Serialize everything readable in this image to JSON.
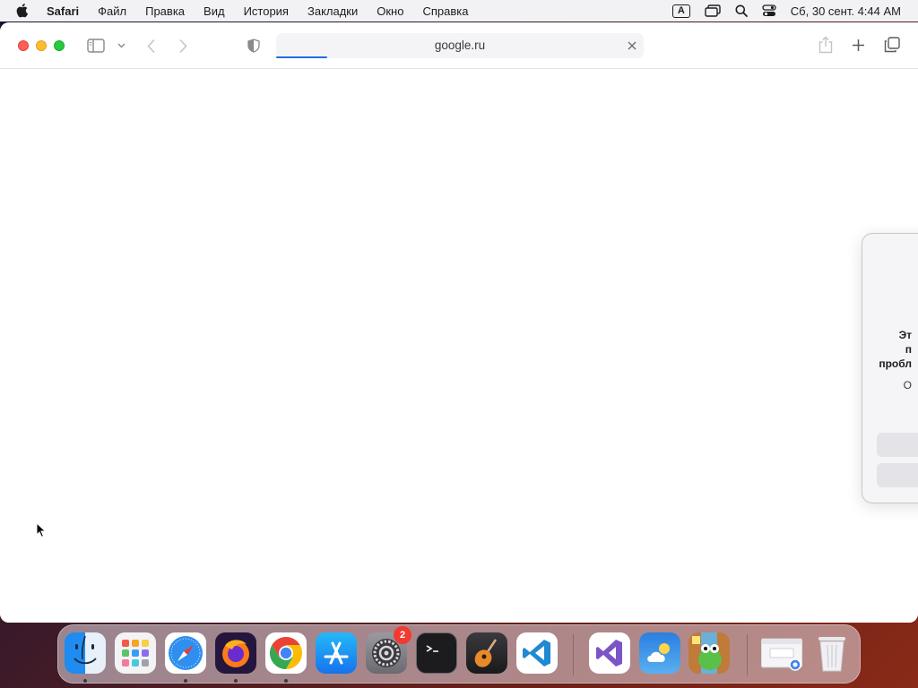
{
  "menubar": {
    "app_name": "Safari",
    "items": [
      "Файл",
      "Правка",
      "Вид",
      "История",
      "Закладки",
      "Окно",
      "Справка"
    ],
    "input_source": "A",
    "clock": "Сб, 30 сент.  4:44 AM",
    "icons": [
      "apple-icon",
      "input-source-icon",
      "screen-mirroring-icon",
      "spotlight-icon",
      "control-center-icon"
    ]
  },
  "safari": {
    "address": "google.ru",
    "load_progress": 0.14,
    "toolbar_icons": [
      "sidebar-icon",
      "chevron-down-icon",
      "back-icon",
      "forward-icon",
      "privacy-shield-icon",
      "close-icon",
      "share-icon",
      "new-tab-icon",
      "tab-overview-icon"
    ]
  },
  "dialog": {
    "line1": "Эт",
    "line2": "п",
    "line3": "пробл",
    "line4": "О"
  },
  "dock": {
    "apps": [
      "Finder",
      "Launchpad",
      "Safari",
      "Firefox",
      "Chrome",
      "App Store",
      "System Settings",
      "Terminal",
      "GarageBand",
      "Visual Studio Code",
      "Visual Studio",
      "Weather",
      "Game",
      "Chrome Window",
      "Trash"
    ],
    "settings_badge": "2"
  },
  "colors": {
    "accent": "#1f6ee0",
    "close": "#fe5f57",
    "minimize": "#febc2e",
    "zoom": "#28c840",
    "badge": "#f23a30"
  }
}
